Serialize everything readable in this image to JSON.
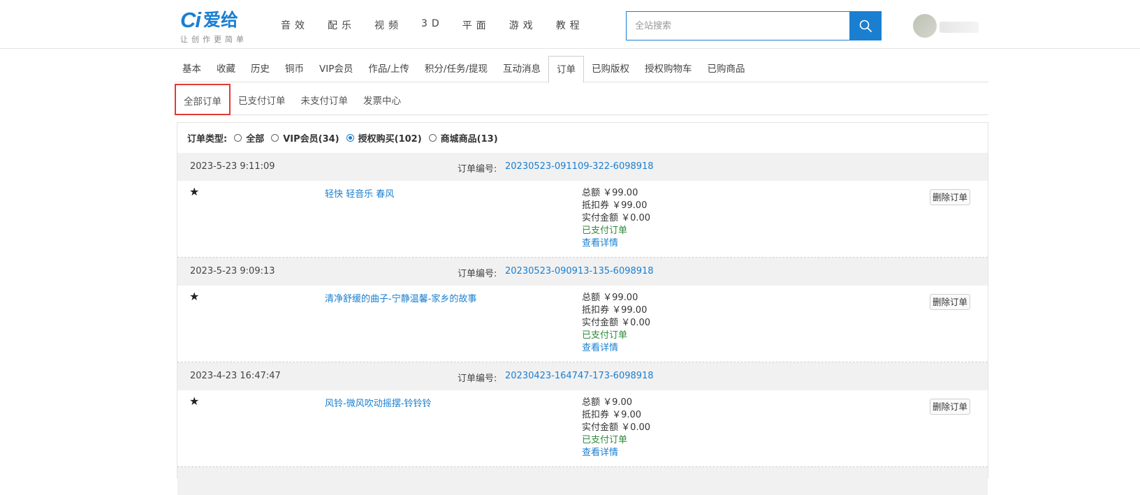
{
  "logo": {
    "mark": "Ci",
    "name": "爱给",
    "tagline": "让创作更简单"
  },
  "main_nav": [
    "音效",
    "配乐",
    "视频",
    "3D",
    "平面",
    "游戏",
    "教程"
  ],
  "search": {
    "placeholder": "全站搜索",
    "icon": "search-icon"
  },
  "tabs": [
    "基本",
    "收藏",
    "历史",
    "铜币",
    "VIP会员",
    "作品/上传",
    "积分/任务/提现",
    "互动消息",
    "订单",
    "已购版权",
    "授权购物车",
    "已购商品"
  ],
  "active_tab": "订单",
  "order_tabs": [
    "全部订单",
    "已支付订单",
    "未支付订单",
    "发票中心"
  ],
  "active_order_tab": "全部订单",
  "filter": {
    "label": "订单类型:",
    "options": [
      "全部",
      "VIP会员(34)",
      "授权购买(102)",
      "商城商品(13)"
    ],
    "selected": "授权购买(102)"
  },
  "order_no_label": "订单编号:",
  "delete_label": "删除订单",
  "orders": [
    {
      "time": "2023-5-23 9:11:09",
      "number": "20230523-091109-322-6098918",
      "product": "轻快 轻音乐 春风",
      "total": "总额 ￥99.00",
      "voucher": "抵扣券 ￥99.00",
      "paid_amount": "实付金额 ￥0.00",
      "status": "已支付订单",
      "detail": "查看详情"
    },
    {
      "time": "2023-5-23 9:09:13",
      "number": "20230523-090913-135-6098918",
      "product": "清净舒缓的曲子-宁静温馨-家乡的故事",
      "total": "总额 ￥99.00",
      "voucher": "抵扣券 ￥99.00",
      "paid_amount": "实付金额 ￥0.00",
      "status": "已支付订单",
      "detail": "查看详情"
    },
    {
      "time": "2023-4-23 16:47:47",
      "number": "20230423-164747-173-6098918",
      "product": "风铃-微风吹动摇摆-铃铃铃",
      "total": "总额 ￥9.00",
      "voucher": "抵扣券 ￥9.00",
      "paid_amount": "实付金额 ￥0.00",
      "status": "已支付订单",
      "detail": "查看详情"
    }
  ],
  "colors": {
    "accent": "#1a7fd1",
    "paid": "#2e8b3a",
    "highlight_box": "#e53935"
  }
}
